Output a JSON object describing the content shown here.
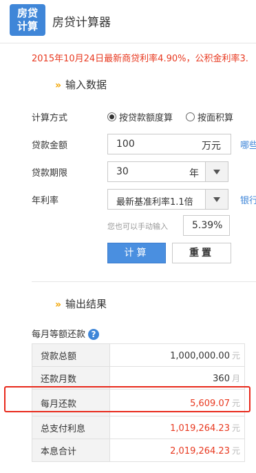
{
  "header": {
    "logo_line1": "房贷",
    "logo_line2": "计算",
    "title": "房贷计算器"
  },
  "notice": "2015年10月24日最新商贷利率4.90%，公积金利率3.",
  "input_section": {
    "title": "输入数据",
    "calc_method": {
      "label": "计算方式",
      "option_amount": "按贷款额度算",
      "option_area": "按面积算",
      "selected": "按贷款额度算"
    },
    "loan_amount": {
      "label": "贷款金额",
      "value": "100",
      "unit": "万元",
      "side_link": "哪些"
    },
    "loan_term": {
      "label": "贷款期限",
      "value": "30",
      "unit": "年"
    },
    "rate": {
      "label": "年利率",
      "selected": "最新基准利率1.1倍",
      "side_link": "银行",
      "manual_hint": "您也可以手动输入",
      "manual_value": "5.39%"
    },
    "calc_button": "计算",
    "reset_button": "重置"
  },
  "output_section": {
    "title": "输出结果",
    "method_label": "每月等额还款",
    "help_glyph": "?",
    "rows": [
      {
        "label": "贷款总额",
        "value": "1,000,000.00",
        "unit": "元"
      },
      {
        "label": "还款月数",
        "value": "360",
        "unit": "月"
      },
      {
        "label": "每月还款",
        "value": "5,609.07",
        "unit": "元"
      },
      {
        "label": "总支付利息",
        "value": "1,019,264.23",
        "unit": "元"
      },
      {
        "label": "本息合计",
        "value": "2,019,264.23",
        "unit": "元"
      }
    ]
  },
  "colors": {
    "accent": "#3f86d8",
    "warning_red": "#e8381f",
    "chevron": "#f2a400",
    "highlight_border": "#e8281a"
  },
  "icons": {
    "section_marker": "double-chevron-icon",
    "help": "question-circle-icon",
    "dropdown": "triangle-down-icon"
  }
}
